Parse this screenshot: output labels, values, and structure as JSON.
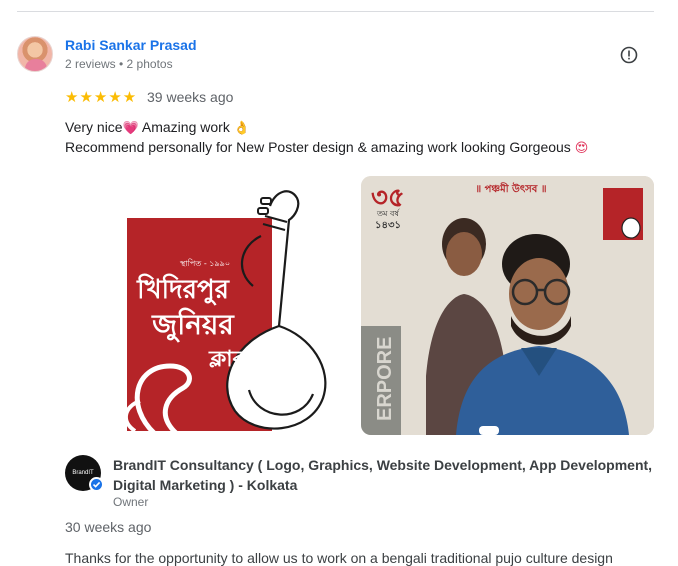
{
  "review": {
    "reviewer_name": "Rabi Sankar Prasad",
    "reviewer_meta": "2 reviews • 2 photos",
    "rating_stars": "★★★★★",
    "rating_value": 5,
    "time_ago": "39 weeks ago",
    "text_line1_part1": "Very nice",
    "text_line1_part2": " Amazing work ",
    "text_line2": "Recommend personally for New Poster design & amazing work looking Gorgeous ",
    "emoji_heart": "💗",
    "emoji_hand": "👌",
    "emoji_face": "😍",
    "report_icon": "flag-icon"
  },
  "photos": {
    "logo": {
      "small_text": "স্থাপিত - ১৯৯০",
      "line1": "খিদিরপুর",
      "line2": "জুনিয়র",
      "line3": "ক্লাব"
    },
    "poster": {
      "number": "৩৫",
      "year_text": "তম বর্ষ",
      "year": "১৪৩১",
      "banner": "॥ পঞ্চমী উৎসব ॥",
      "side_text": "ERPORE"
    }
  },
  "owner_response": {
    "owner_name": "BrandIT Consultancy ( Logo, Graphics, Website Development, App Development, Digital Marketing ) - Kolkata",
    "owner_role": "Owner",
    "avatar_text": "BrandIT Consultancy",
    "time_ago": "30 weeks ago",
    "text": "Thanks for the opportunity to allow us to work on a bengali traditional pujo culture design"
  }
}
